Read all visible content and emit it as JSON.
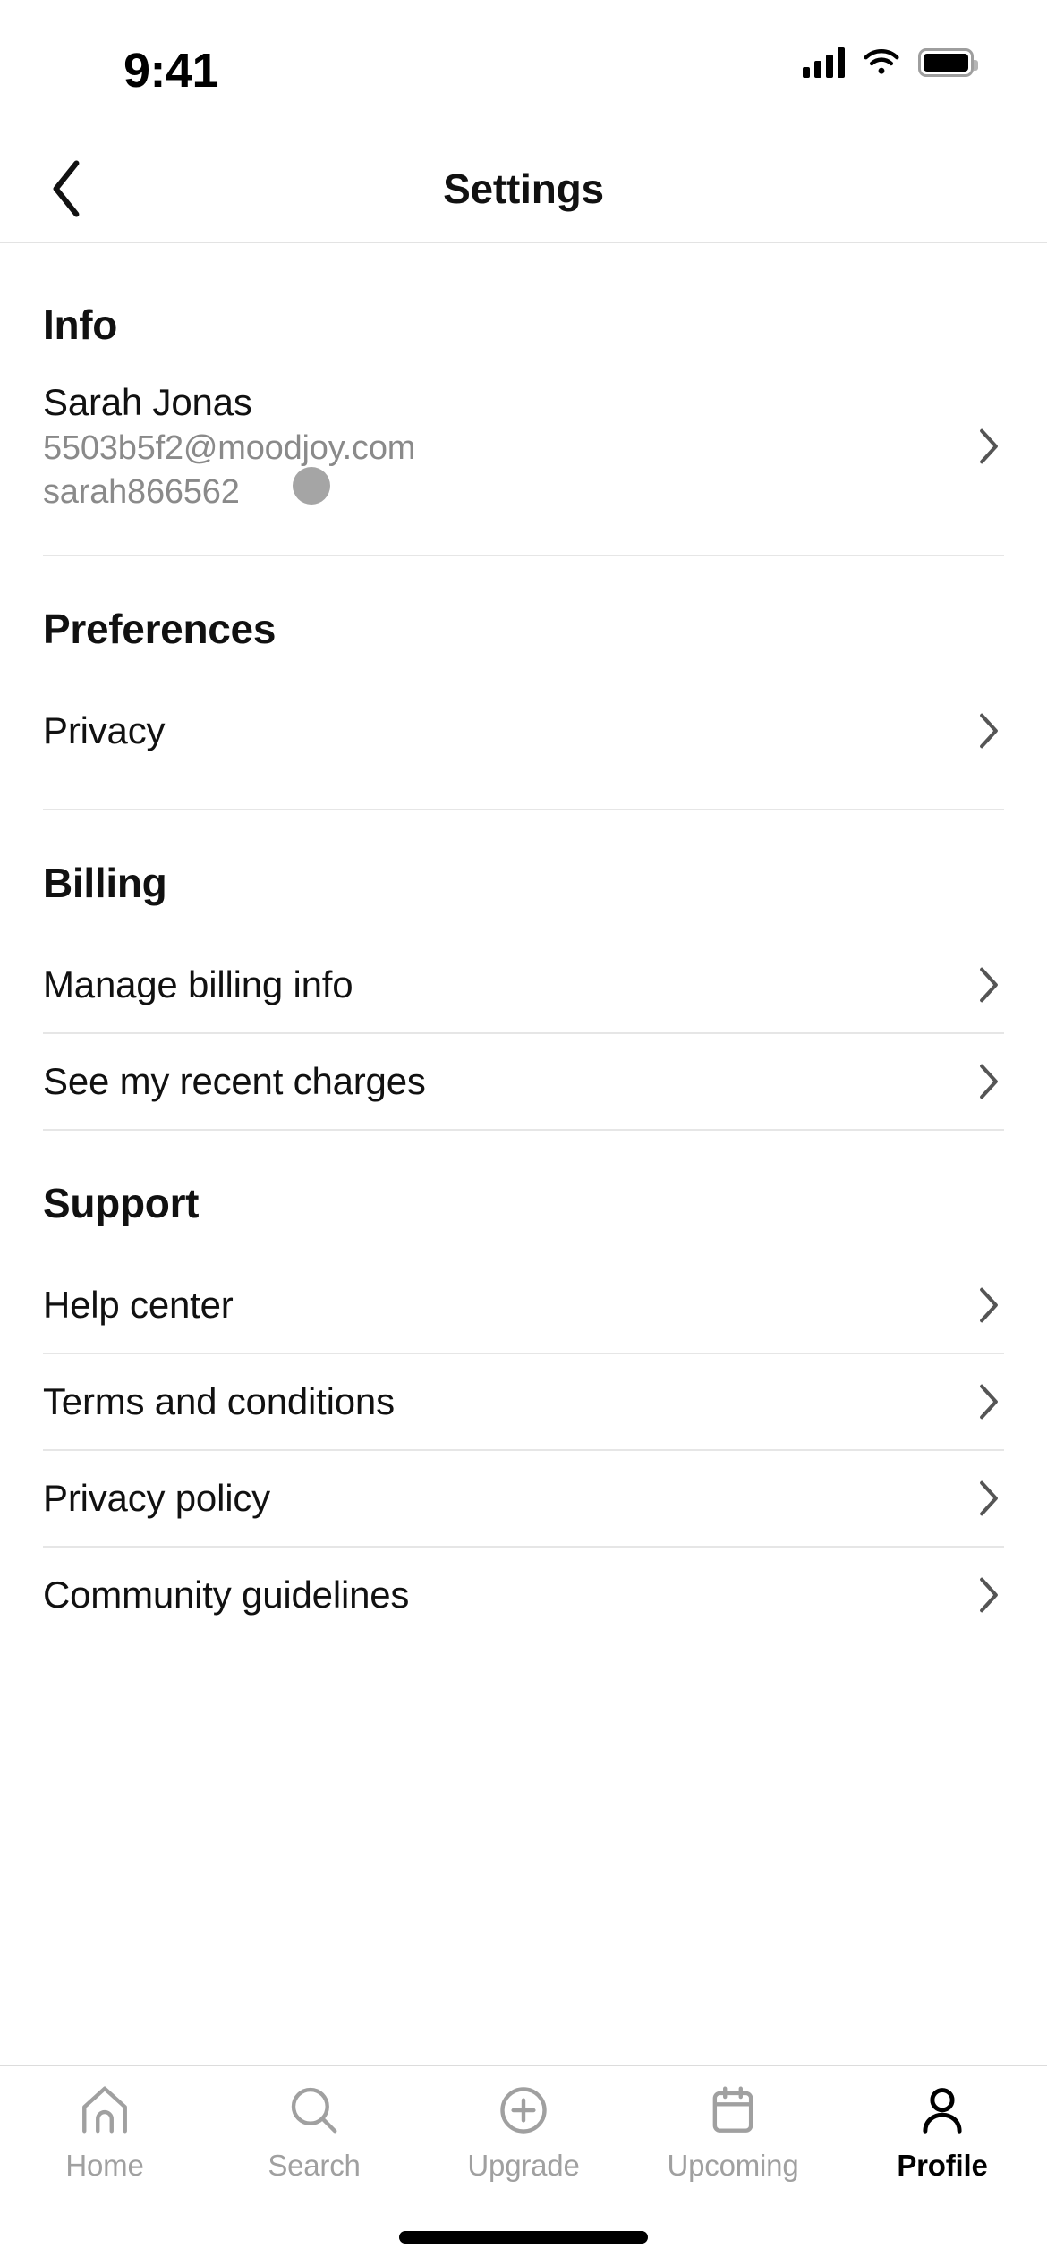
{
  "status_bar": {
    "time": "9:41",
    "signal_icon": "cellular-signal-icon",
    "wifi_icon": "wifi-icon",
    "battery_icon": "battery-icon"
  },
  "navbar": {
    "back_icon": "chevron-left-icon",
    "title": "Settings"
  },
  "sections": [
    {
      "heading": "Info",
      "type": "account",
      "account": {
        "name": "Sarah Jonas",
        "email": "5503b5f2@moodjoy.com",
        "username": "sarah866562",
        "chevron": "chevron-right-icon"
      }
    },
    {
      "heading": "Preferences",
      "type": "list",
      "items": [
        {
          "label": "Privacy",
          "chevron": "chevron-right-icon"
        }
      ]
    },
    {
      "heading": "Billing",
      "type": "list",
      "items": [
        {
          "label": "Manage billing info",
          "chevron": "chevron-right-icon"
        },
        {
          "label": "See my recent charges",
          "chevron": "chevron-right-icon"
        }
      ]
    },
    {
      "heading": "Support",
      "type": "list",
      "items": [
        {
          "label": "Help center",
          "chevron": "chevron-right-icon"
        },
        {
          "label": "Terms and conditions",
          "chevron": "chevron-right-icon"
        },
        {
          "label": "Privacy policy",
          "chevron": "chevron-right-icon"
        },
        {
          "label": "Community guidelines",
          "chevron": "chevron-right-icon"
        }
      ]
    }
  ],
  "tabbar": {
    "items": [
      {
        "label": "Home",
        "icon": "home-icon",
        "active": false
      },
      {
        "label": "Search",
        "icon": "search-icon",
        "active": false
      },
      {
        "label": "Upgrade",
        "icon": "plus-circle-icon",
        "active": false
      },
      {
        "label": "Upcoming",
        "icon": "calendar-icon",
        "active": false
      },
      {
        "label": "Profile",
        "icon": "person-icon",
        "active": true
      }
    ]
  },
  "colors": {
    "text_primary": "#111111",
    "text_muted": "#8a8a8a",
    "tab_inactive": "#a0a0a0",
    "tab_active": "#000000",
    "divider": "#e6e6e6",
    "chevron": "#555555",
    "cursor": "#6e6e6e"
  },
  "home_indicator": "home-indicator"
}
